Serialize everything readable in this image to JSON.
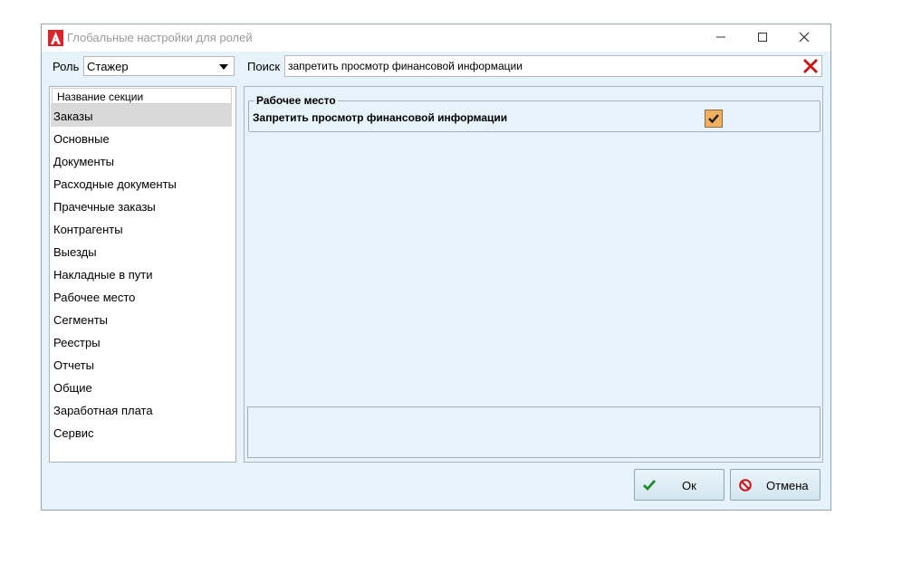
{
  "window": {
    "title": "Глобальные настройки для ролей",
    "app_icon": "red-A-logo-icon"
  },
  "controls": {
    "minimize": "minimize-icon",
    "maximize": "maximize-icon",
    "close": "close-icon"
  },
  "filter": {
    "role_label": "Роль",
    "role_value": "Стажер",
    "search_label": "Поиск",
    "search_value": "запретить просмотр финансовой информации"
  },
  "sections": {
    "header": "Название секции",
    "selected_index": 0,
    "items": [
      "Заказы",
      "Основные",
      "Документы",
      "Расходные документы",
      "Прачечные заказы",
      "Контрагенты",
      "Выезды",
      "Накладные в пути",
      "Рабочее место",
      "Сегменты",
      "Реестры",
      "Отчеты",
      "Общие",
      "Заработная плата",
      "Сервис"
    ]
  },
  "settings": {
    "group_title": "Рабочее место",
    "setting_label": "Запретить просмотр финансовой информации",
    "checked": true,
    "check_color": "#f0b060"
  },
  "buttons": {
    "ok": "Ок",
    "cancel": "Отмена"
  },
  "colors": {
    "background": "#e6f3fa",
    "selection": "#d9d9d9",
    "ok_icon": "#1a8a2a",
    "cancel_icon": "#cc1111",
    "clear_icon": "#cc1111"
  }
}
